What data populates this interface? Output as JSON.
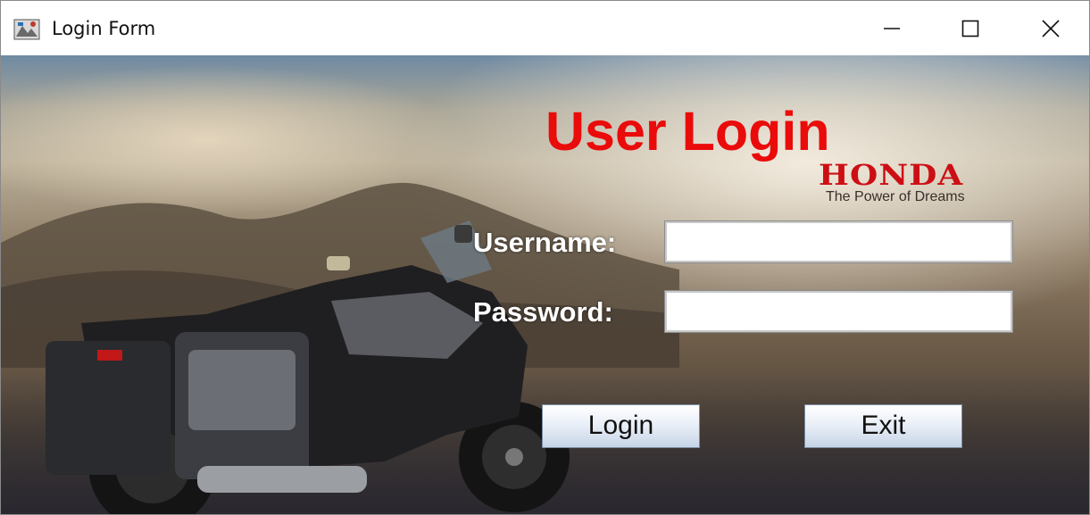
{
  "window": {
    "title": "Login Form",
    "icon": "app-window-icon",
    "controls": [
      "minimize-icon",
      "maximize-icon",
      "close-icon"
    ]
  },
  "form": {
    "heading": "User Login",
    "brand": {
      "name": "HONDA",
      "tagline": "The Power of Dreams",
      "color": "#cc0f14"
    },
    "username_label": "Username:",
    "username_value": "",
    "password_label": "Password:",
    "password_value": "",
    "login_label": "Login",
    "exit_label": "Exit"
  },
  "colors": {
    "heading": "#ea0b0b",
    "label": "#ffffff"
  }
}
